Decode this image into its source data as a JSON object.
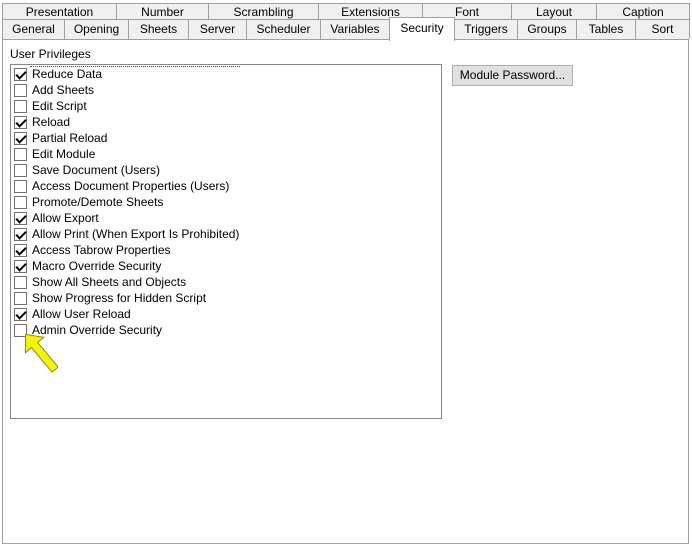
{
  "tabs_row1": [
    "Presentation",
    "Number",
    "Scrambling",
    "Extensions",
    "Font",
    "Layout",
    "Caption"
  ],
  "tabs_row2": [
    "General",
    "Opening",
    "Sheets",
    "Server",
    "Scheduler",
    "Variables",
    "Security",
    "Triggers",
    "Groups",
    "Tables",
    "Sort"
  ],
  "active_tab": "Security",
  "privileges_label": "User Privileges",
  "module_password_button": "Module Password...",
  "privileges": [
    {
      "label": "Reduce Data",
      "checked": true
    },
    {
      "label": "Add Sheets",
      "checked": false
    },
    {
      "label": "Edit Script",
      "checked": false
    },
    {
      "label": "Reload",
      "checked": true
    },
    {
      "label": "Partial Reload",
      "checked": true
    },
    {
      "label": "Edit Module",
      "checked": false
    },
    {
      "label": "Save Document (Users)",
      "checked": false
    },
    {
      "label": "Access Document Properties (Users)",
      "checked": false
    },
    {
      "label": "Promote/Demote Sheets",
      "checked": false
    },
    {
      "label": "Allow Export",
      "checked": true
    },
    {
      "label": "Allow Print (When Export Is Prohibited)",
      "checked": true
    },
    {
      "label": "Access Tabrow Properties",
      "checked": true
    },
    {
      "label": "Macro Override Security",
      "checked": true
    },
    {
      "label": "Show All Sheets and Objects",
      "checked": false
    },
    {
      "label": "Show Progress for Hidden Script",
      "checked": false
    },
    {
      "label": "Allow User Reload",
      "checked": true
    },
    {
      "label": "Admin Override Security",
      "checked": false
    }
  ],
  "arrow_color": "#f5f500"
}
